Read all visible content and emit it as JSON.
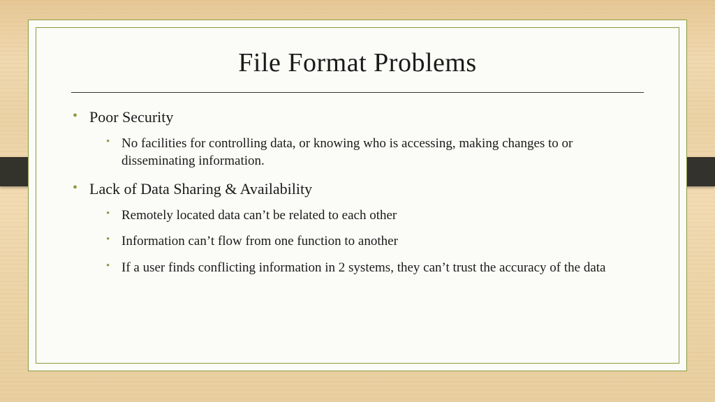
{
  "slide": {
    "title": "File Format Problems",
    "bullets": [
      {
        "text": "Poor Security",
        "children": [
          "No facilities for controlling data, or knowing who is accessing, making changes to or disseminating information."
        ]
      },
      {
        "text": "Lack of Data Sharing & Availability",
        "children": [
          "Remotely located data can’t be related to each other",
          "Information can’t flow from one function to another",
          "If a user finds conflicting information in 2 systems, they can’t trust the accuracy of the data"
        ]
      }
    ]
  }
}
